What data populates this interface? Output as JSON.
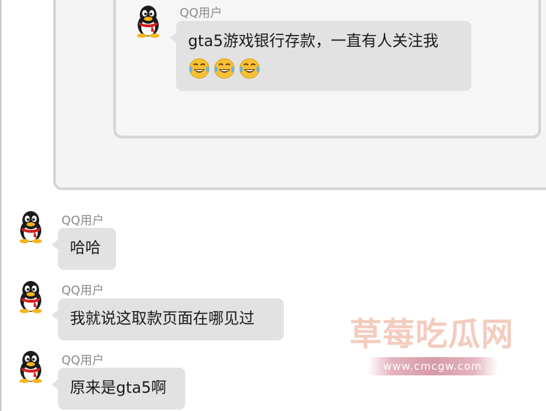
{
  "quoted": {
    "username": "QQ用户",
    "message": "gta5游戏银行存款，一直有人关注我",
    "emojis": [
      "laugh-cry-emoji",
      "laugh-cry-emoji",
      "laugh-cry-emoji"
    ]
  },
  "messages": [
    {
      "username": "QQ用户",
      "text": "哈哈"
    },
    {
      "username": "QQ用户",
      "text": "我就说这取款页面在哪见过"
    },
    {
      "username": "QQ用户",
      "text": "原来是gta5啊"
    }
  ],
  "watermark": {
    "title": "草莓吃瓜网",
    "url": "www.cmcgw.com"
  },
  "colors": {
    "bubble": "#e2e2e2",
    "username": "#8a8a8a",
    "frame_border": "#d6d6d6",
    "watermark_text": "#f2c4b4"
  }
}
